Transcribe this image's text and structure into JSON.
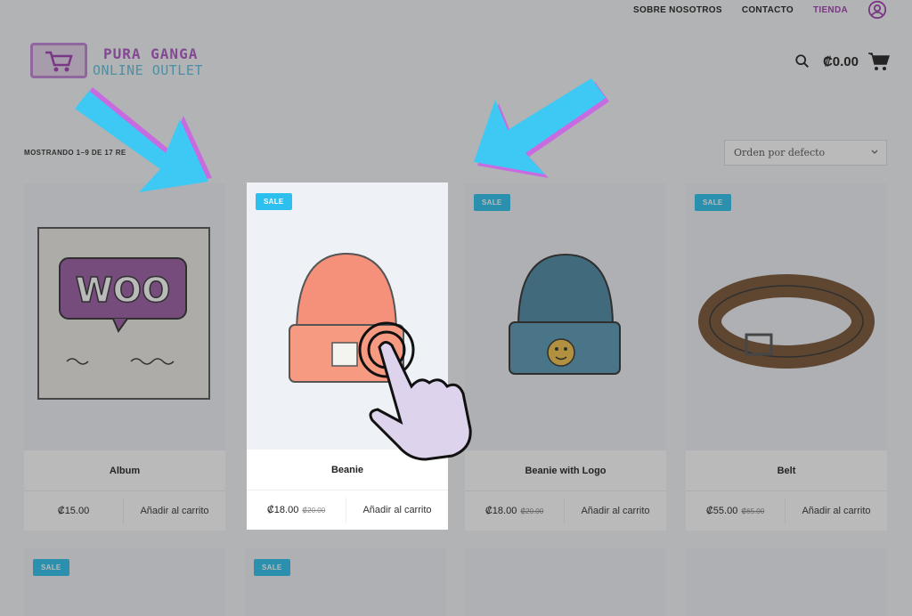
{
  "nav": {
    "links": [
      "SOBRE NOSOTROS",
      "CONTACTO",
      "TIENDA"
    ],
    "active": "TIENDA",
    "account_icon": "user-circle-icon"
  },
  "logo": {
    "line1": "PURA GANGA",
    "line2": "ONLINE OUTLET"
  },
  "header": {
    "cart_total": "₡0.00",
    "search_icon": "search-icon",
    "cart_icon": "cart-icon"
  },
  "shop": {
    "result_count": "MOSTRANDO 1–9 DE 17 RE",
    "sort_selected": "Orden por defecto"
  },
  "products": [
    {
      "name": "Album",
      "price": "₡15.00",
      "old_price": "",
      "sale": false,
      "add_label": "Añadir al carrito"
    },
    {
      "name": "Beanie",
      "price": "₡18.00",
      "old_price": "₡20.00",
      "sale": true,
      "add_label": "Añadir al carrito"
    },
    {
      "name": "Beanie with Logo",
      "price": "₡18.00",
      "old_price": "₡20.00",
      "sale": true,
      "add_label": "Añadir al carrito"
    },
    {
      "name": "Belt",
      "price": "₡55.00",
      "old_price": "₡65.00",
      "sale": true,
      "add_label": "Añadir al carrito"
    }
  ],
  "sale_label": "SALE",
  "colors": {
    "accent_purple": "#a03fb0",
    "sale_blue": "#2dc0ee",
    "arrow_blue": "#3ec9f5",
    "arrow_shadow": "#c86be0"
  }
}
